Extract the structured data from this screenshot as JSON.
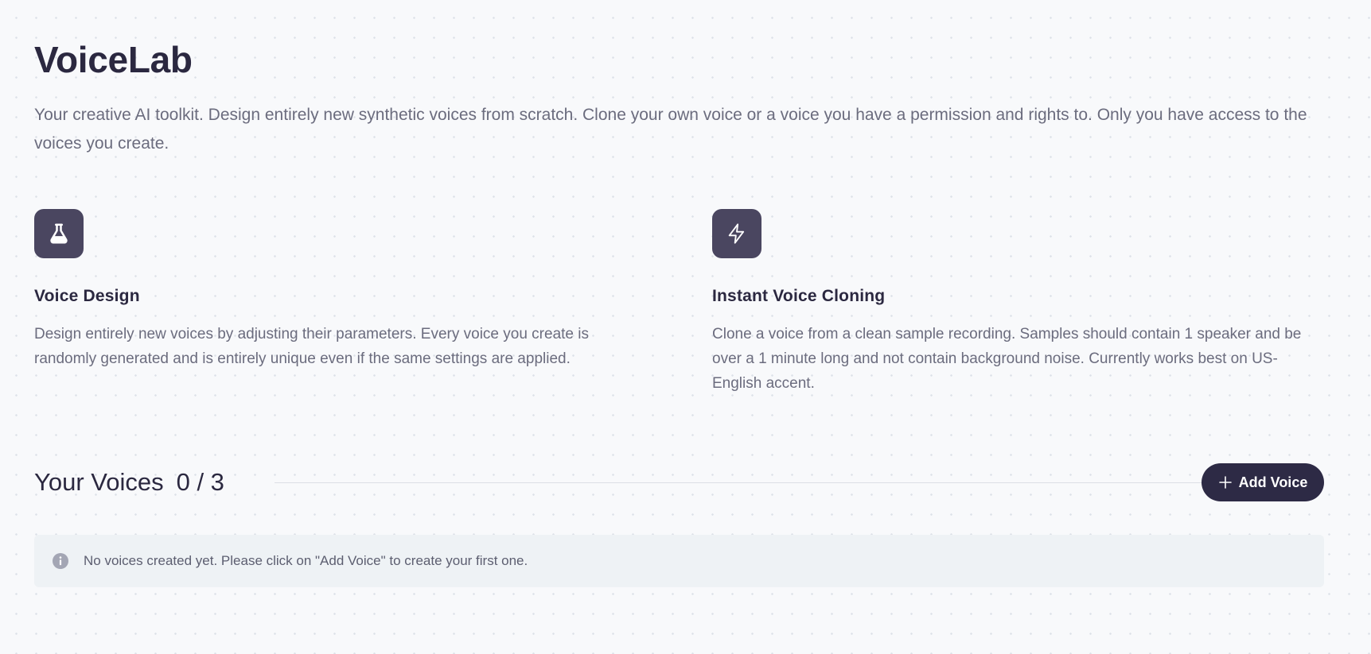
{
  "app": {
    "title": "VoiceLab",
    "intro": "Your creative AI toolkit. Design entirely new synthetic voices from scratch. Clone your own voice or a voice you have a permission and rights to. Only you have access to the voices you create."
  },
  "features": [
    {
      "icon": "flask-icon",
      "title": "Voice Design",
      "description": "Design entirely new voices by adjusting their parameters. Every voice you create is randomly generated and is entirely unique even if the same settings are applied."
    },
    {
      "icon": "lightning-icon",
      "title": "Instant Voice Cloning",
      "description": "Clone a voice from a clean sample recording. Samples should contain 1 speaker and be over a 1 minute long and not contain background noise. Currently works best on US-English accent."
    }
  ],
  "voices": {
    "title": "Your Voices",
    "count": "0 / 3",
    "add_button_label": "Add Voice",
    "empty_message": "No voices created yet. Please click on \"Add Voice\" to create your first one."
  },
  "colors": {
    "background": "#f8f9fb",
    "primary_dark": "#2d2a45",
    "icon_tile": "#4a4660",
    "info_box": "#eef2f5"
  }
}
